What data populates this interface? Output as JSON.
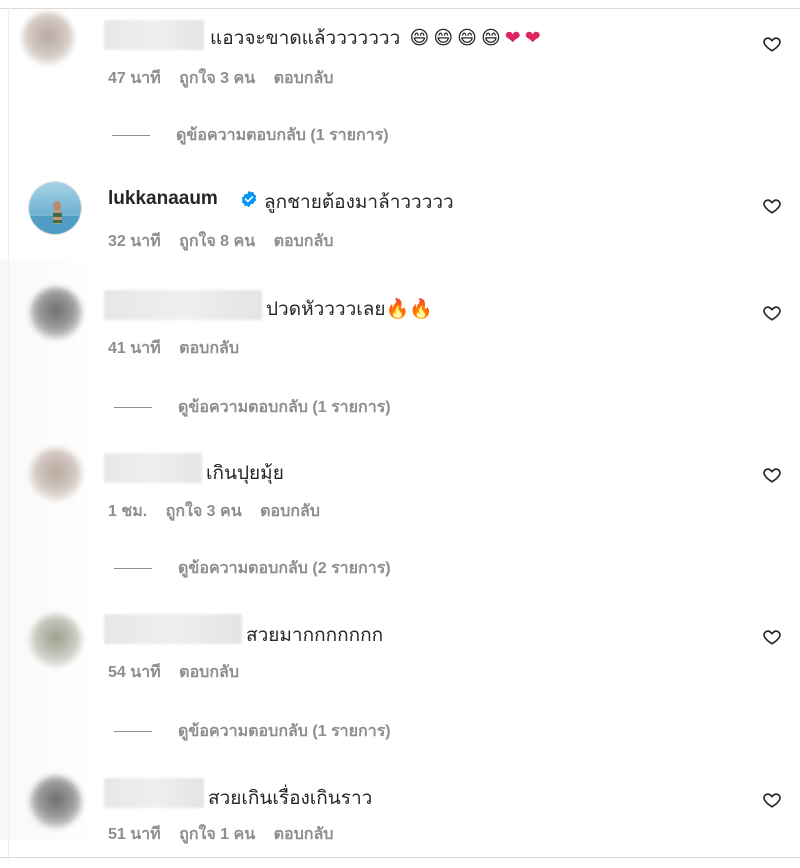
{
  "comments": [
    {
      "text": "แอวจะขาดแล้ววววววว",
      "emojis": [
        "😄",
        "😄",
        "😄",
        "😄"
      ],
      "hearts": [
        "❤",
        "❤"
      ],
      "time": "47 นาที",
      "likes": "ถูกใจ 3 คน",
      "reply": "ตอบกลับ",
      "view_replies": "ดูข้อความตอบกลับ (1 รายการ)"
    },
    {
      "username": "lukkanaaum",
      "text": "ลูกชายต้องมาล้าววววว",
      "time": "32 นาที",
      "likes": "ถูกใจ 8 คน",
      "reply": "ตอบกลับ"
    },
    {
      "text": "ปวดหัววววเลย",
      "fire": [
        "🔥",
        "🔥"
      ],
      "time": "41 นาที",
      "reply": "ตอบกลับ",
      "view_replies": "ดูข้อความตอบกลับ (1 รายการ)"
    },
    {
      "text": "เกินปุยมุ้ย",
      "time": "1 ชม.",
      "likes": "ถูกใจ 3 คน",
      "reply": "ตอบกลับ",
      "view_replies": "ดูข้อความตอบกลับ (2 รายการ)"
    },
    {
      "text": "สวยมากกกกกกก",
      "time": "54 นาที",
      "reply": "ตอบกลับ",
      "view_replies": "ดูข้อความตอบกลับ (1 รายการ)"
    },
    {
      "text": "สวยเกินเรื่องเกินราว",
      "time": "51 นาที",
      "likes": "ถูกใจ 1 คน",
      "reply": "ตอบกลับ"
    }
  ],
  "icons": {
    "like": "heart-outline-icon",
    "verified": "verified-badge-icon"
  },
  "colors": {
    "text": "#262626",
    "meta": "#8e8e8e",
    "verified": "#0095f6",
    "heart_red": "#e0245e"
  }
}
